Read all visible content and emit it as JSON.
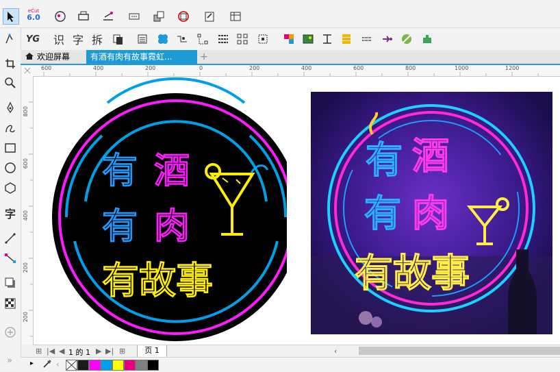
{
  "toolbar_top": {
    "badge_app": "eCut",
    "badge_ver": "6.0"
  },
  "toolbar_second": {
    "btn_shi": "识",
    "btn_zi": "字",
    "btn_chai": "拆"
  },
  "tabs": {
    "home_label": "欢迎屏幕",
    "doc_label": "有酒有肉有故事霓虹...",
    "add": "+"
  },
  "ruler_h": [
    "600",
    "400",
    "200",
    "0",
    "200",
    "400",
    "600",
    "800",
    "1000",
    "1200"
  ],
  "ruler_v": [
    "800",
    "600",
    "400",
    "200",
    "0",
    "200"
  ],
  "left_tools": {
    "text_tool": "字"
  },
  "sign": {
    "line1": "有酒",
    "line2": "有肉",
    "line3": "有故事"
  },
  "photo": {
    "line1": "有酒",
    "line2": "有肉",
    "line3": "有故事"
  },
  "pagebar": {
    "page_count": "1 的 1",
    "page_tab": "页 1"
  },
  "palette": {
    "colors": [
      "#1a1a1a",
      "#ff00ff",
      "#00a0e9",
      "#ffff00",
      "#e4007f",
      "#808080",
      "#000000"
    ]
  },
  "colors": {
    "accent": "#1e9bd7",
    "neon_pink": "#ff1aff",
    "neon_blue": "#1e9bff",
    "neon_yellow": "#ffee00"
  }
}
